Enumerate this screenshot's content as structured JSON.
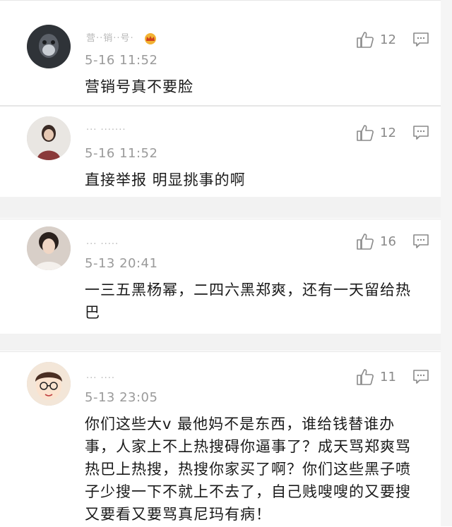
{
  "comments": [
    {
      "username": "营··销··号·",
      "time": "5-16 11:52",
      "text": "营销号真不要脸",
      "likes": "12",
      "like_icon": "thumbs-up-icon",
      "reply_icon": "reply-icon",
      "badge": "crown-icon"
    },
    {
      "username": "··· ·······",
      "time": "5-16 11:52",
      "text": "直接举报  明显挑事的啊",
      "likes": "12",
      "like_icon": "thumbs-up-icon",
      "reply_icon": "reply-icon"
    },
    {
      "username": "··· ·····",
      "time": "5-13 20:41",
      "text": "一三五黑杨幂，二四六黑郑爽，还有一天留给热巴",
      "likes": "16",
      "like_icon": "thumbs-up-icon",
      "reply_icon": "reply-icon"
    },
    {
      "username": "··· ····",
      "time": "5-13 23:05",
      "text": "你们这些大v 最他妈不是东西，谁给钱替谁办事，人家上不上热搜碍你逼事了？成天骂郑爽骂热巴上热搜，热搜你家买了啊？你们这些黑子喷子少搜一下不就上不去了，自己贱嗖嗖的又要搜又要看又要骂真尼玛有病！",
      "likes": "11",
      "like_icon": "thumbs-up-icon",
      "reply_icon": "reply-icon"
    }
  ]
}
